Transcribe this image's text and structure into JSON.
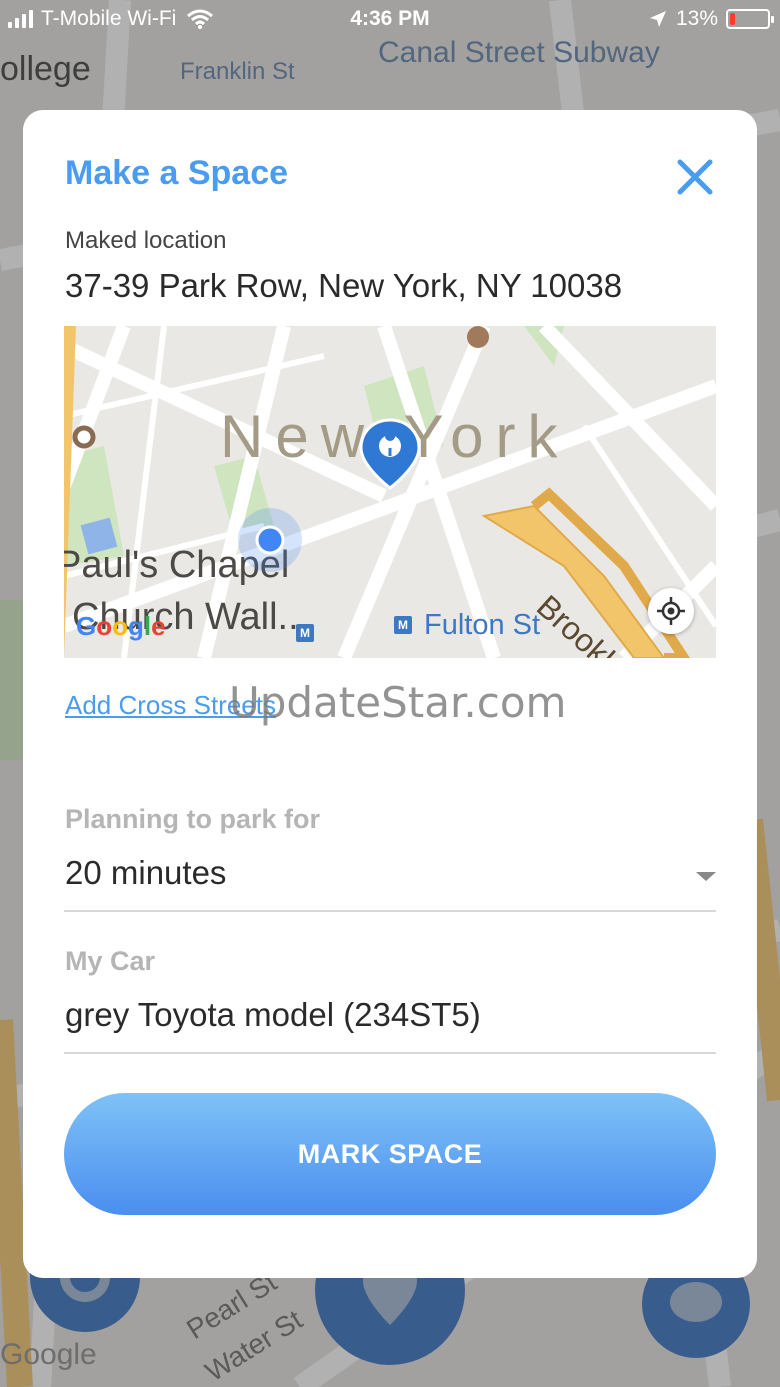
{
  "status_bar": {
    "carrier": "T-Mobile Wi-Fi",
    "time": "4:36 PM",
    "battery": "13%",
    "battery_level": 0.13
  },
  "background": {
    "canal_label": "Canal Street Subway",
    "franklin_label": "Franklin St",
    "college_label": "ollege",
    "google_label": "Google",
    "pearl_label": "Pearl St",
    "water_label": "Water St"
  },
  "modal": {
    "title": "Make a Space",
    "close_icon": "close-icon",
    "location_label": "Maked location",
    "address": "37-39 Park Row, New York, NY 10038",
    "map": {
      "city_label": "New York",
      "chapel_label": "Paul's Chapel",
      "church_label": "Church Wall...",
      "fulton_label": "Fulton St",
      "brooklyn_label": "Brookl",
      "google_logo": "Google",
      "metro_glyph": "M",
      "pin_icon": "location-pin-icon",
      "locate_icon": "my-location-icon"
    },
    "cross_streets_link": "Add Cross Streets",
    "watermark": "UpdateStar.com",
    "park_label": "Planning to park for",
    "park_value": "20 minutes",
    "car_label": "My Car",
    "car_value": "grey Toyota model (234ST5)",
    "submit_label": "MARK SPACE"
  },
  "colors": {
    "accent": "#4a9cf0",
    "button_top": "#7fc2f7",
    "button_bottom": "#4a8ef0",
    "battery_low": "#ff3b30"
  }
}
